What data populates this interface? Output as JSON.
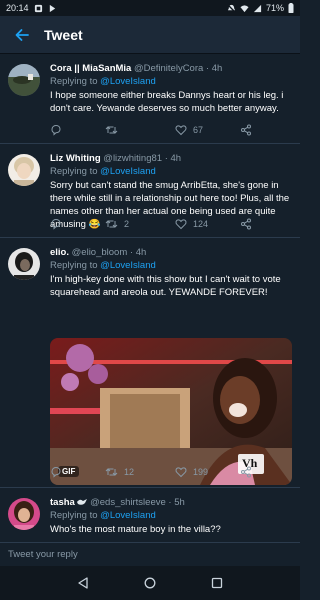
{
  "status_bar": {
    "time": "20:14",
    "battery": "71%"
  },
  "header": {
    "title": "Tweet"
  },
  "tweets": [
    {
      "display_name": "Cora || MiaSanMia",
      "handle": "@DefinitelyCora · 4h",
      "reply_prefix": "Replying to ",
      "reply_to": "@LoveIsland",
      "text": "I hope someone either breaks Dannys heart or his leg. i don't care. Yewande deserves so much better anyway.",
      "retweets": "",
      "likes": "67"
    },
    {
      "display_name": "Liz Whiting",
      "handle": "@lizwhiting81 · 4h",
      "reply_prefix": "Replying to ",
      "reply_to": "@LoveIsland",
      "text": "Sorry but can't stand the smug ArribEtta, she's gone in there while still in a relationship out here too! Plus, all the names other than her actual one being used are quite amusing 😂",
      "retweets": "2",
      "likes": "124"
    },
    {
      "display_name": "elio.",
      "handle": "@elio_bloom · 4h",
      "reply_prefix": "Replying to ",
      "reply_to": "@LoveIsland",
      "text": "I'm high-key done with this show but I can't wait to vote squarehead and areola out. YEWANDE FOREVER!",
      "media_badge": "GIF",
      "media_watermark": "Vh",
      "retweets": "12",
      "likes": "199"
    },
    {
      "display_name": "tasha",
      "handle": "@eds_shirtsleeve · 5h",
      "reply_prefix": "Replying to ",
      "reply_to": "@LoveIsland",
      "text": "Who's the most mature boy in the villa??"
    }
  ],
  "composer": {
    "placeholder": "Tweet your reply"
  },
  "colors": {
    "background": "#15202b",
    "accent": "#1da1f2",
    "muted": "#8899a6"
  }
}
